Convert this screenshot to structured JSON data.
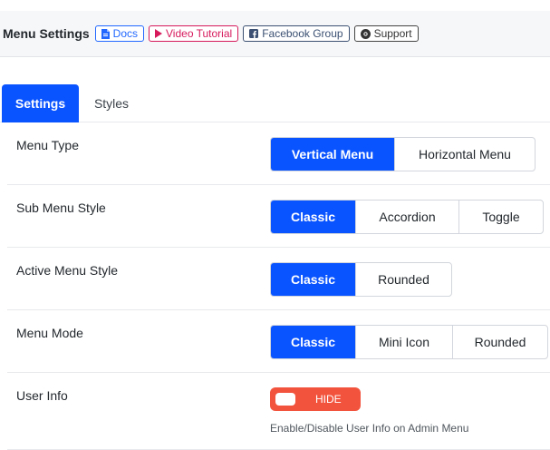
{
  "header": {
    "title": "Menu Settings",
    "buttons": [
      {
        "label": "Docs",
        "icon": "document-icon",
        "color": "#2268ff"
      },
      {
        "label": "Video Tutorial",
        "icon": "play-icon",
        "color": "#d6195b"
      },
      {
        "label": "Facebook Group",
        "icon": "facebook-icon",
        "color": "#3b5072"
      },
      {
        "label": "Support",
        "icon": "lifebuoy-icon",
        "color": "#444444"
      }
    ]
  },
  "tabs": [
    {
      "label": "Settings",
      "active": true
    },
    {
      "label": "Styles",
      "active": false
    }
  ],
  "settings": {
    "menu_type": {
      "label": "Menu Type",
      "options": [
        "Vertical Menu",
        "Horizontal Menu"
      ],
      "selected": "Vertical Menu"
    },
    "sub_menu_style": {
      "label": "Sub Menu Style",
      "options": [
        "Classic",
        "Accordion",
        "Toggle"
      ],
      "selected": "Classic"
    },
    "active_menu_style": {
      "label": "Active Menu Style",
      "options": [
        "Classic",
        "Rounded"
      ],
      "selected": "Classic"
    },
    "menu_mode": {
      "label": "Menu Mode",
      "options": [
        "Classic",
        "Mini Icon",
        "Rounded"
      ],
      "selected": "Classic"
    },
    "user_info": {
      "label": "User Info",
      "toggle_label": "HIDE",
      "enabled": false,
      "hint": "Enable/Disable User Info on Admin Menu"
    }
  },
  "colors": {
    "accent": "#0a54ff",
    "toggle_off": "#f2533d"
  }
}
